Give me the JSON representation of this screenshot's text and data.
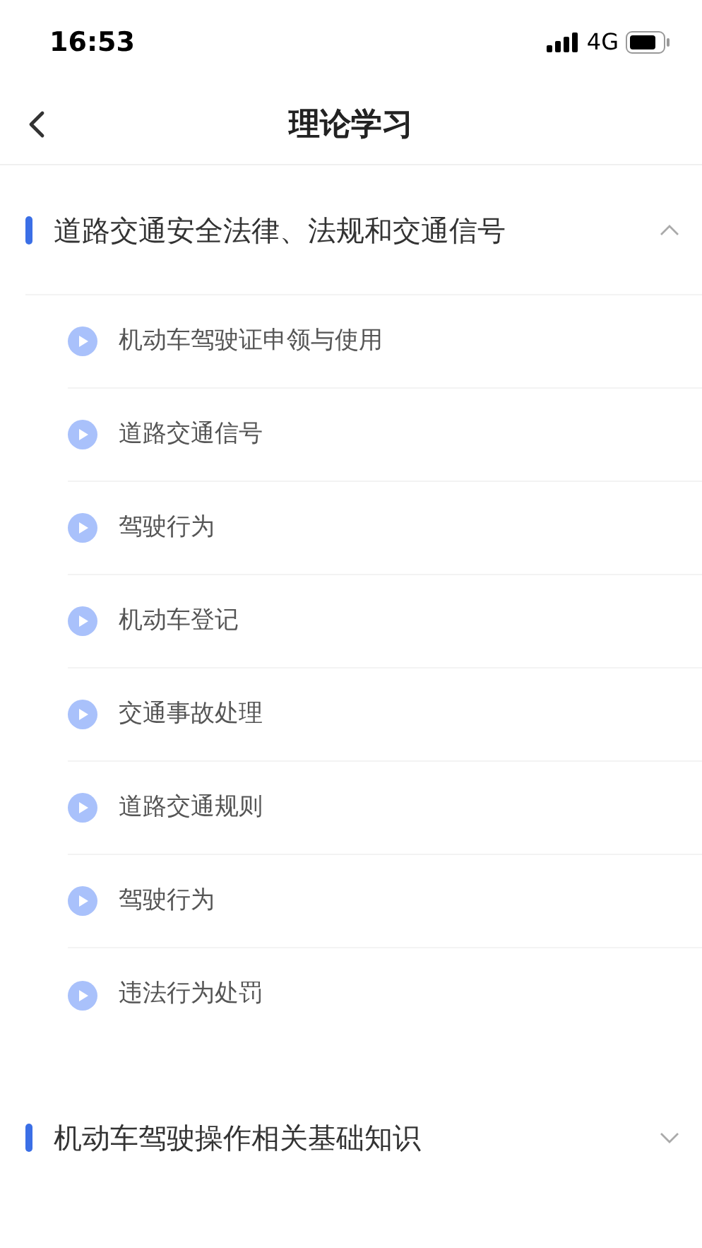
{
  "status_bar": {
    "time": "16:53",
    "network": "4G"
  },
  "nav": {
    "title": "理论学习"
  },
  "sections": [
    {
      "title": "道路交通安全法律、法规和交通信号",
      "expanded": true,
      "lessons": [
        {
          "title": "机动车驾驶证申领与使用"
        },
        {
          "title": "道路交通信号"
        },
        {
          "title": "驾驶行为"
        },
        {
          "title": "机动车登记"
        },
        {
          "title": "交通事故处理"
        },
        {
          "title": "道路交通规则"
        },
        {
          "title": "驾驶行为"
        },
        {
          "title": "违法行为处罚"
        }
      ]
    },
    {
      "title": "机动车驾驶操作相关基础知识",
      "expanded": false
    }
  ]
}
